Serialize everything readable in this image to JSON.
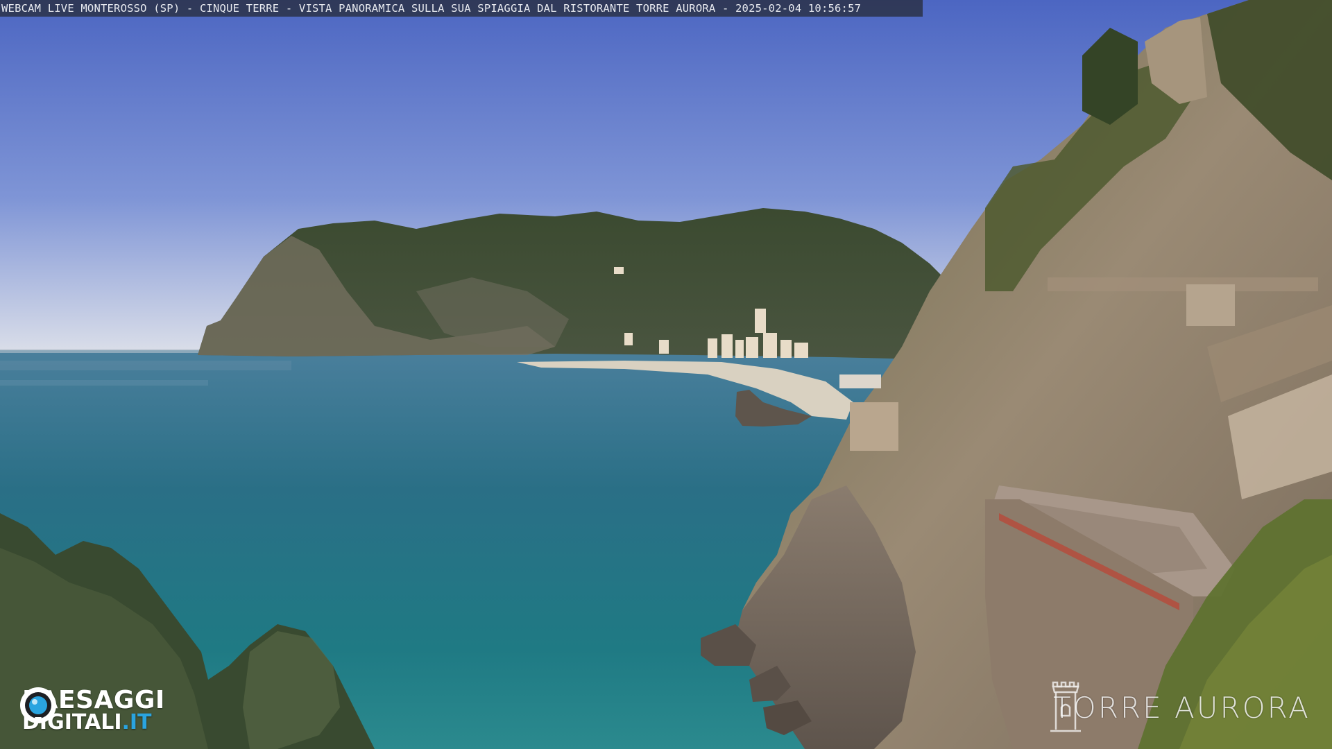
{
  "overlay": {
    "caption": "WEBCAM LIVE MONTEROSSO (SP) - CINQUE TERRE - VISTA PANORAMICA SULLA SUA SPIAGGIA DAL RISTORANTE TORRE AURORA - 2025-02-04 10:56:57"
  },
  "watermark_left": {
    "line1": "PAESAGGI",
    "line2_main": "DIGITALI",
    "line2_accent": ".IT",
    "accent_color": "#2aa4e0"
  },
  "watermark_right": {
    "text": "TORRE AURORA"
  },
  "scene": {
    "icon": "webcam-landscape",
    "colors": {
      "sky_top": "#5b74c9",
      "sky_horizon": "#d9dde6",
      "sea_far": "#3f7f9a",
      "sea_near": "#1f7a86",
      "hills": "#3f4f33",
      "cliff": "#8a7a68",
      "beach": "#d8d0c0"
    }
  }
}
